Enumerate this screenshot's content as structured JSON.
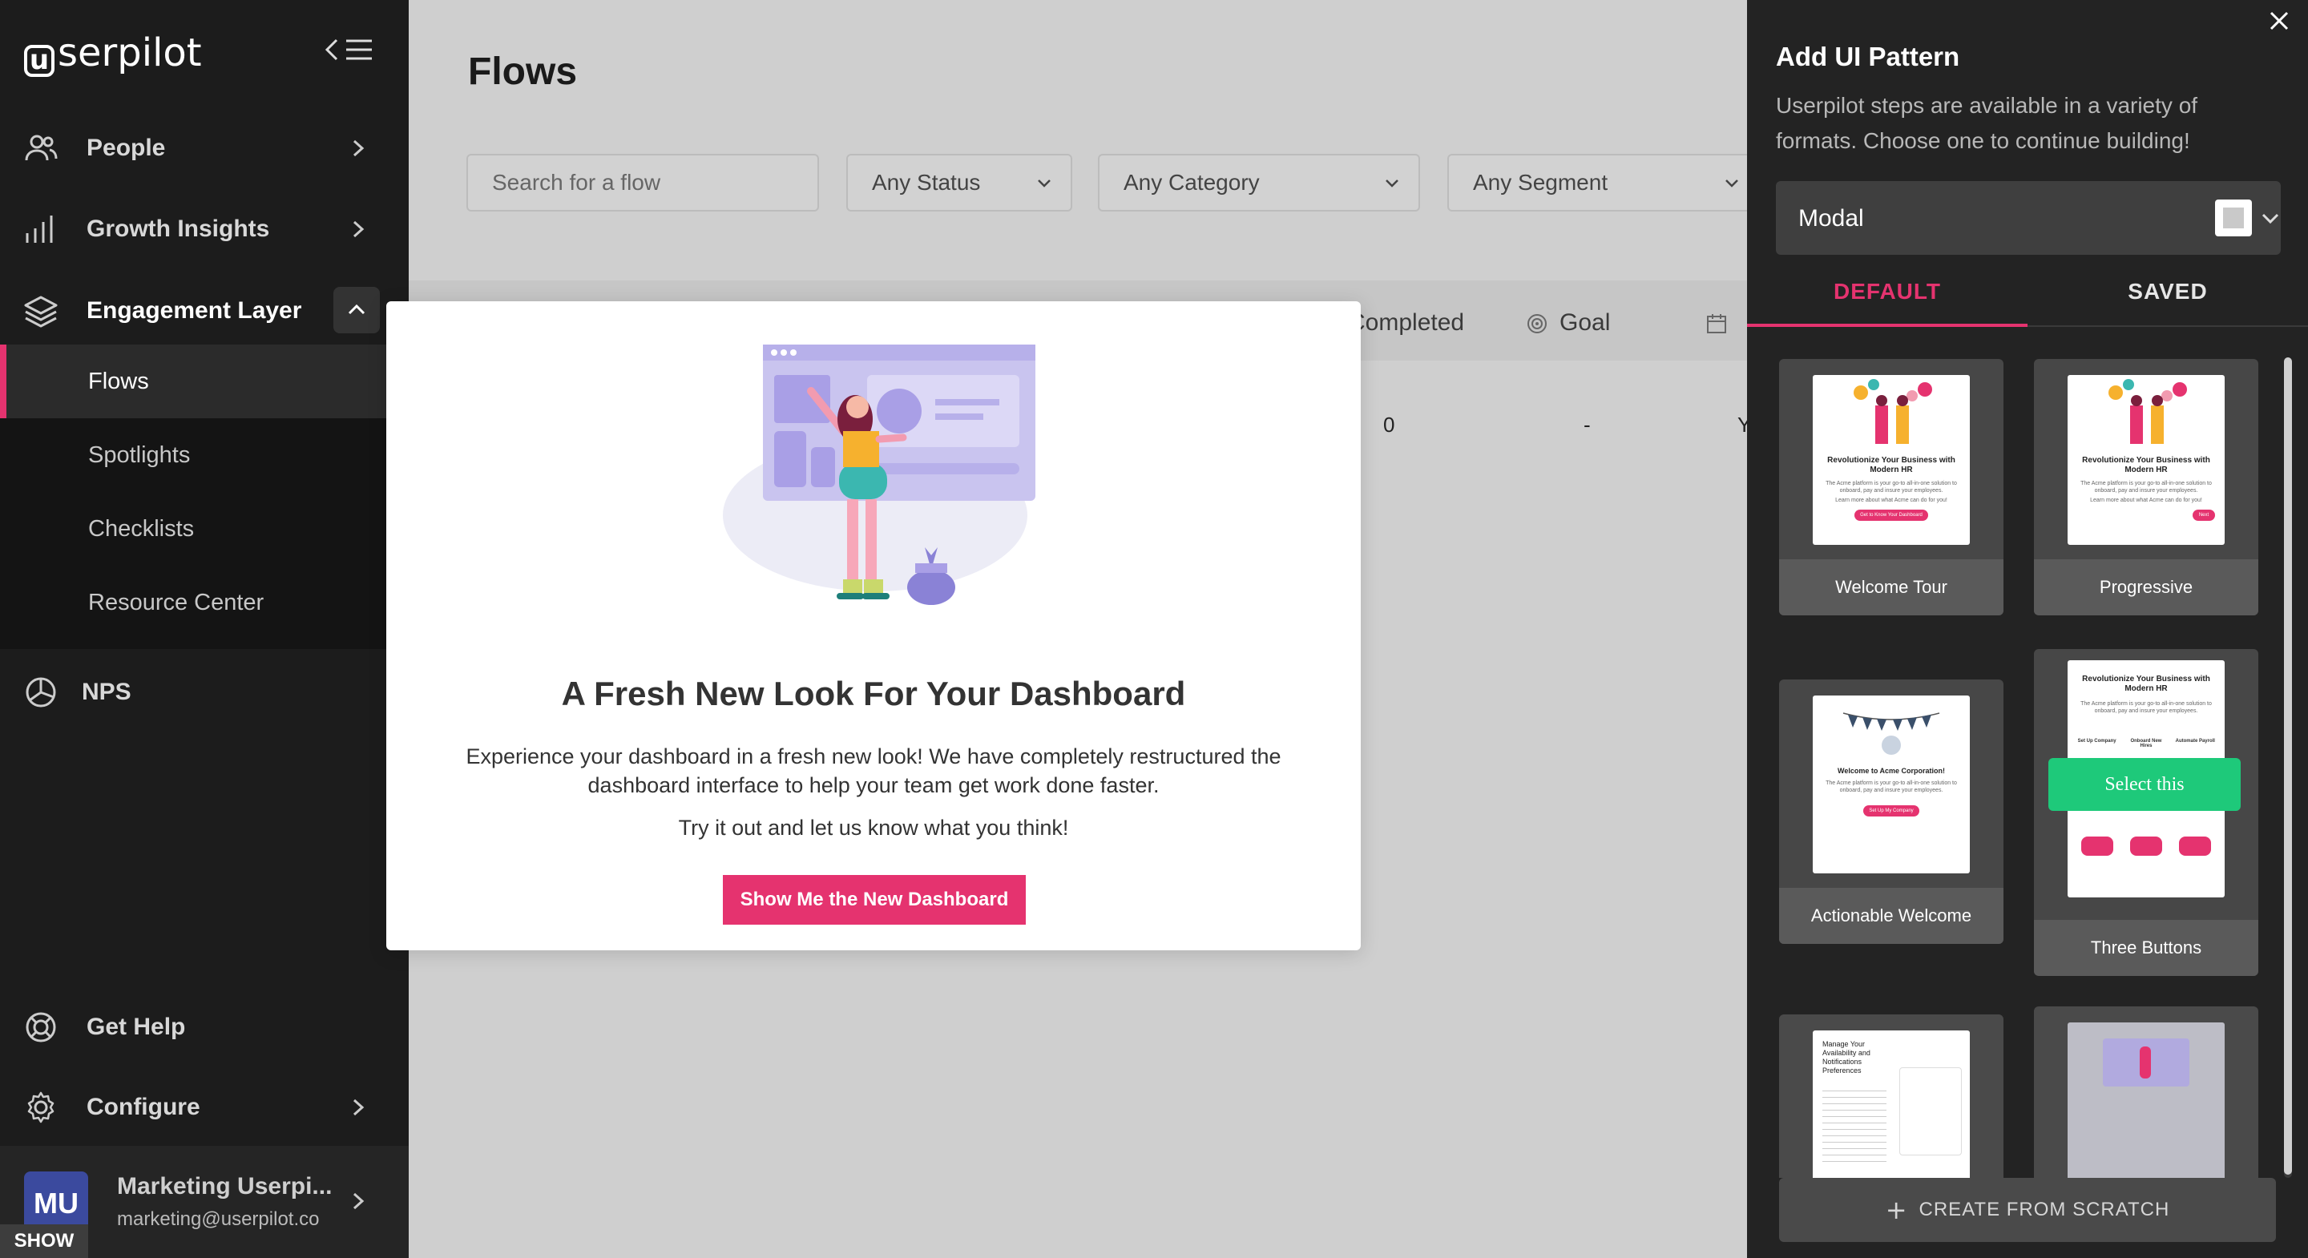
{
  "brand": {
    "logo_mark": "u",
    "logo_text": "serpilot",
    "accent": "#e5336f",
    "select_accent": "#1ec97a"
  },
  "sidebar": {
    "items": [
      {
        "label": "People",
        "icon": "people-icon",
        "expandable": true
      },
      {
        "label": "Growth Insights",
        "icon": "bar-chart-icon",
        "expandable": true
      },
      {
        "label": "Engagement Layer",
        "icon": "layers-icon",
        "expanded": true
      },
      {
        "label": "NPS",
        "icon": "pie-icon",
        "expandable": false
      },
      {
        "label": "Get Help",
        "icon": "lifebuoy-icon",
        "expandable": false
      },
      {
        "label": "Configure",
        "icon": "gear-icon",
        "expandable": true
      }
    ],
    "sub_items": [
      "Flows",
      "Spotlights",
      "Checklists",
      "Resource Center"
    ],
    "active_sub": "Flows",
    "user": {
      "initials": "MU",
      "name": "Marketing Userpi...",
      "email": "marketing@userpilot.co",
      "badge": "SHOW"
    }
  },
  "main": {
    "title": "Flows",
    "search_placeholder": "Search for a flow",
    "filters": [
      "Any Status",
      "Any Category",
      "Any Segment"
    ],
    "columns": [
      "Completed",
      "Goal"
    ],
    "row": {
      "completed": "0",
      "goal": "-",
      "extra": "Y"
    }
  },
  "modal": {
    "heading": "A Fresh New Look For Your Dashboard",
    "body": "Experience your dashboard in a fresh new look! We have completely restructured the dashboard interface to help your team get work done faster.",
    "body2": "Try it out and let us know what you think!",
    "cta": "Show Me the New Dashboard"
  },
  "panel": {
    "title": "Add UI Pattern",
    "description": "Userpilot steps are available in a variety of formats. Choose one to continue building!",
    "format": "Modal",
    "tabs": [
      "DEFAULT",
      "SAVED"
    ],
    "active_tab": "DEFAULT",
    "cards": [
      "Welcome Tour",
      "Progressive",
      "Actionable Welcome",
      "Three Buttons"
    ],
    "thumb_text": {
      "hr_title": "Revolutionize Your Business with Modern HR",
      "hr_desc": "The Acme platform is your go-to all-in-one solution to onboard, pay and insure your employees.",
      "hr_learn": "Learn more about what Acme can do for you!",
      "btn_show": "Get to Know Your Dashboard",
      "btn_next": "Next",
      "welcome_title": "Welcome to Acme Corporation!",
      "welcome_cta": "Set Up My Company",
      "three_cols": [
        "Set Up Company",
        "Onboard New Hires",
        "Automate Payroll"
      ],
      "notif_title": "Manage Your Availability and Notifications Preferences"
    },
    "select_this": "Select this",
    "create_label": "CREATE FROM SCRATCH"
  }
}
